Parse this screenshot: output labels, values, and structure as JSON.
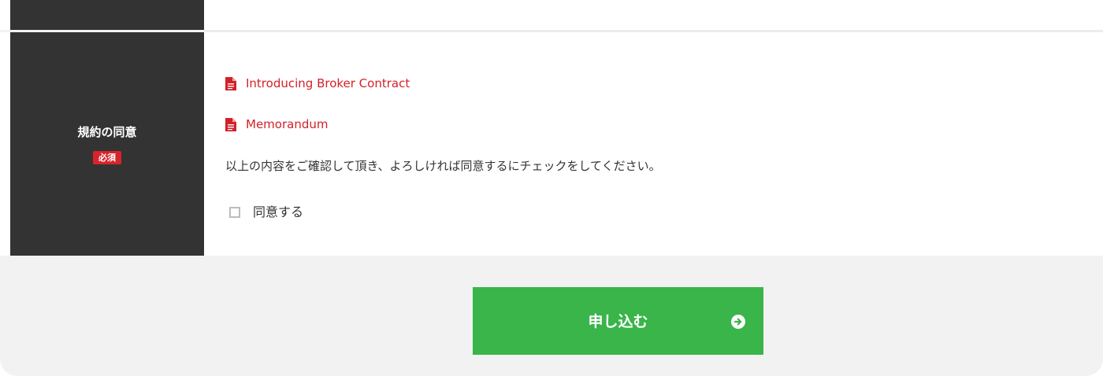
{
  "agreement": {
    "label": "規約の同意",
    "required_badge": "必須",
    "links": [
      {
        "text": "Introducing Broker Contract",
        "icon": "document-icon"
      },
      {
        "text": "Memorandum",
        "icon": "document-icon"
      }
    ],
    "instruction": "以上の内容をご確認して頂き、よろしければ同意するにチェックをしてください。",
    "checkbox_label": "同意する",
    "checked": false
  },
  "submit": {
    "label": "申し込む",
    "icon": "arrow-circle-right-icon"
  },
  "colors": {
    "label_bg": "#333333",
    "required": "#d7242a",
    "link": "#d42028",
    "submit_bg": "#39b54a",
    "page_bg": "#f2f2f2"
  }
}
